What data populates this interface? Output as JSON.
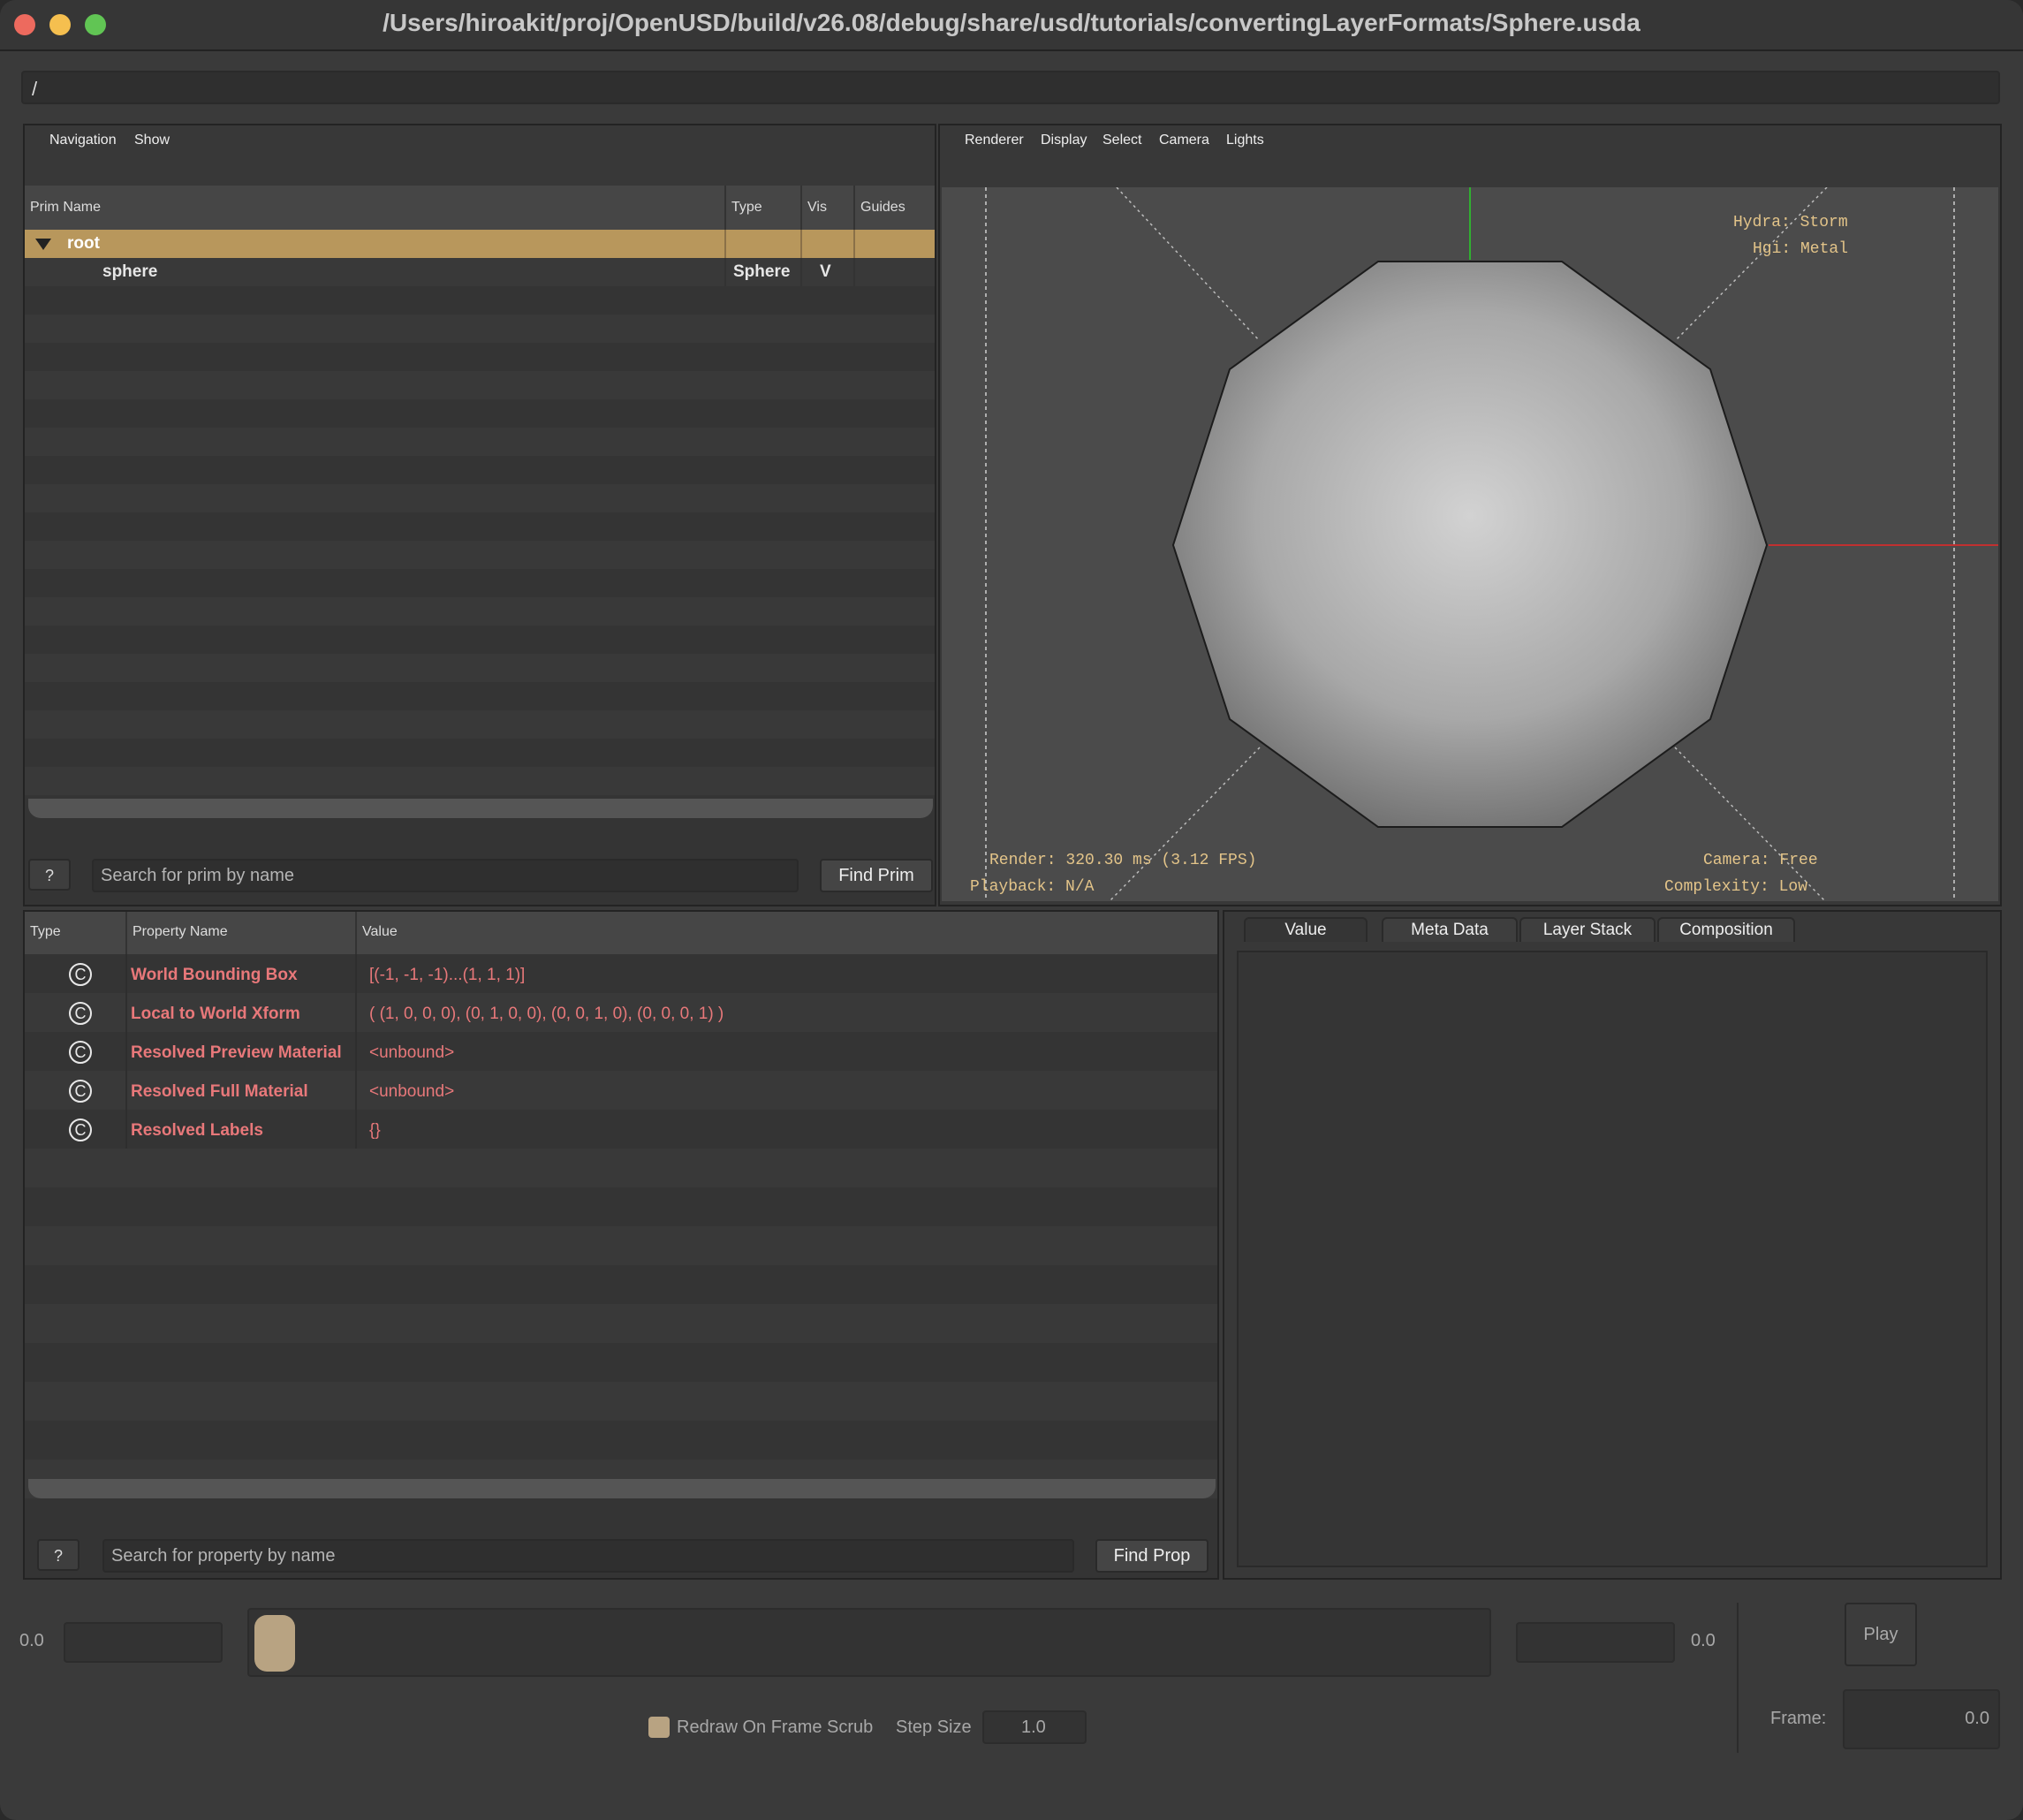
{
  "window": {
    "title": "/Users/hiroakit/proj/OpenUSD/build/v26.08/debug/share/usd/tutorials/convertingLayerFormats/Sphere.usda"
  },
  "path_bar": {
    "value": "/"
  },
  "prim_browser": {
    "menu": [
      "Navigation",
      "Show"
    ],
    "columns": {
      "name": "Prim Name",
      "type": "Type",
      "vis": "Vis",
      "guides": "Guides"
    },
    "rows": [
      {
        "name": "root",
        "type": "",
        "vis": "",
        "selected": true,
        "expanded": true
      },
      {
        "name": "sphere",
        "type": "Sphere",
        "vis": "V",
        "selected": false
      }
    ],
    "help_label": "?",
    "search_placeholder": "Search for prim by name",
    "find_label": "Find Prim"
  },
  "viewport": {
    "menu": [
      "Renderer",
      "Display",
      "Select",
      "Camera",
      "Lights"
    ],
    "hud_top_right": [
      "Hydra: Storm",
      "Hgi: Metal"
    ],
    "hud_bottom_left": [
      "Render: 320.30 ms (3.12 FPS)",
      "Playback: N/A"
    ],
    "hud_bottom_right": [
      "Camera: Free",
      "Complexity: Low"
    ],
    "colors": {
      "hud": "#e3c489",
      "background": "#4b4b4b",
      "x_axis": "#c03030",
      "y_axis": "#30b030"
    }
  },
  "property_browser": {
    "columns": {
      "type": "Type",
      "name": "Property Name",
      "value": "Value"
    },
    "rows": [
      {
        "icon": "C",
        "name": "World Bounding Box",
        "value": "[(-1, -1, -1)...(1, 1, 1)]"
      },
      {
        "icon": "C",
        "name": "Local to World Xform",
        "value": "( (1, 0, 0, 0), (0, 1, 0, 0), (0, 0, 1, 0), (0, 0, 0, 1) )"
      },
      {
        "icon": "C",
        "name": "Resolved Preview Material",
        "value": "<unbound>"
      },
      {
        "icon": "C",
        "name": "Resolved Full Material",
        "value": "<unbound>"
      },
      {
        "icon": "C",
        "name": "Resolved Labels",
        "value": "{}"
      }
    ],
    "help_label": "?",
    "search_placeholder": "Search for property by name",
    "find_label": "Find Prop"
  },
  "inspector": {
    "tabs": [
      "Value",
      "Meta Data",
      "Layer Stack",
      "Composition"
    ],
    "active_tab": "Value"
  },
  "timeline": {
    "start_label": "0.0",
    "end_label": "0.0",
    "play_label": "Play",
    "redraw_label": "Redraw On Frame Scrub",
    "redraw_checked": true,
    "step_size_label": "Step Size",
    "step_size_value": "1.0",
    "frame_label": "Frame:",
    "frame_value": "0.0"
  }
}
